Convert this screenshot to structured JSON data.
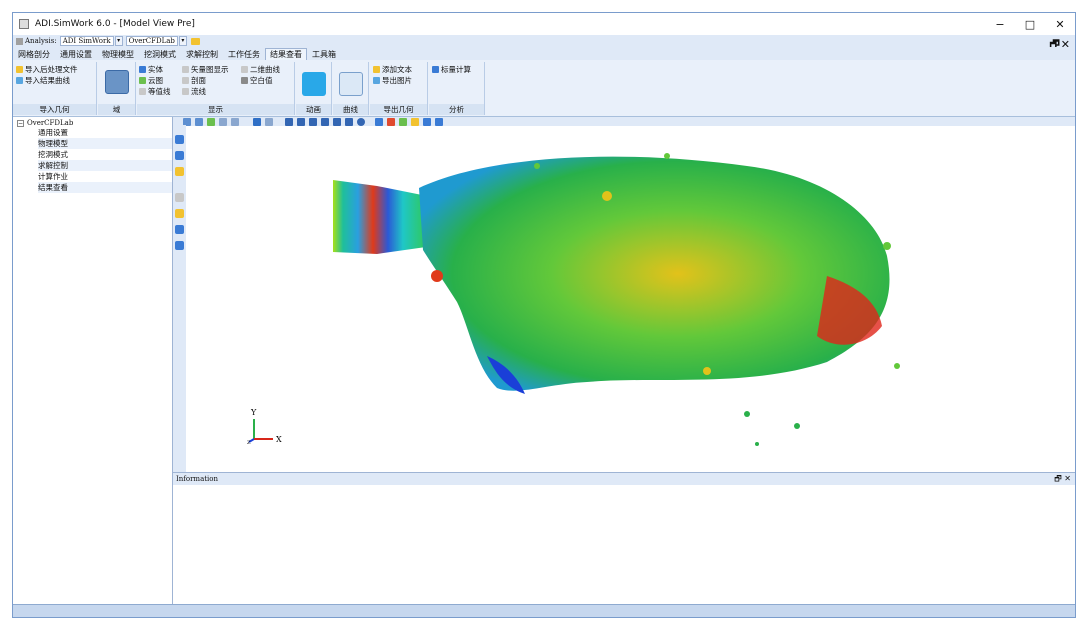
{
  "window": {
    "title": "ADI.SimWork 6.0 - [Model View Pre]",
    "controls": {
      "minimize": "−",
      "maximize": "□",
      "close": "✕"
    }
  },
  "quick_access": {
    "analysis_label": "Analysis:",
    "analysis_value": "ADI SimWork",
    "project_value": "OverCFDLab"
  },
  "mdi_controls": "_🗗✕",
  "tabs": [
    "网格剖分",
    "通用设置",
    "物理模型",
    "挖洞模式",
    "求解控制",
    "工作任务",
    "结果查看",
    "工具箱"
  ],
  "active_tab": "结果查看",
  "ribbon": {
    "import": {
      "items": [
        "导入后处理文件",
        "导入结果曲线"
      ],
      "label": "导入几何"
    },
    "domain": {
      "label": "域"
    },
    "display": {
      "col1": [
        "实体",
        "云图",
        "等值线"
      ],
      "col2": [
        "矢量图显示",
        "剖面",
        "流线"
      ],
      "col3": [
        "二维曲线",
        "空白值"
      ],
      "label": "显示"
    },
    "animation": {
      "label": "动画"
    },
    "curve": {
      "label": "曲线"
    },
    "export": {
      "items": [
        "添加文本",
        "导出图片"
      ],
      "label": "导出几何"
    },
    "analysis": {
      "items": [
        "标量计算"
      ],
      "label": "分析"
    }
  },
  "tree": {
    "root": "OverCFDLab",
    "nodes": [
      "通用设置",
      "物理模型",
      "挖洞模式",
      "求解控制",
      "计算作业",
      "结果查看"
    ]
  },
  "viewport": {
    "axis_y": "Y",
    "axis_x": "X",
    "axis_z": "Z"
  },
  "info_panel": {
    "title": "Information",
    "controls": "🗗 ✕"
  },
  "colors": {
    "ribbon_bg": "#e9f0fa",
    "tab_bg": "#dfe9f7",
    "status_bar": "#c6d7ee",
    "field_low": "#1a3fd8",
    "field_mid": "#33c23a",
    "field_high": "#e0261a"
  }
}
